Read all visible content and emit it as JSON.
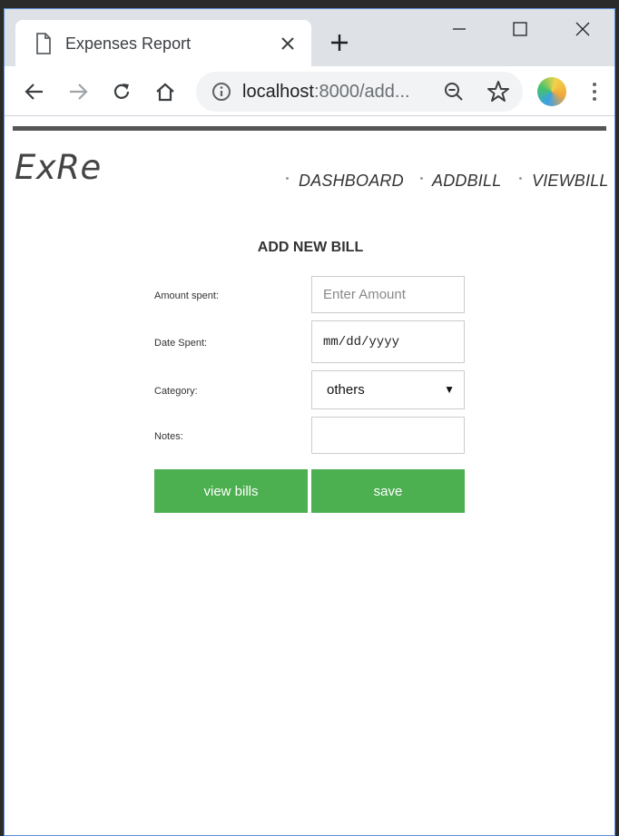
{
  "browser": {
    "tab_title": "Expenses Report",
    "url_host": "localhost",
    "url_rest": ":8000/add..."
  },
  "app": {
    "logo": "ExRe",
    "nav": [
      {
        "label": "DASHBOARD"
      },
      {
        "label": "ADDBILL"
      },
      {
        "label": "VIEWBILL"
      }
    ]
  },
  "form": {
    "title": "ADD NEW BILL",
    "amount_label": "Amount spent:",
    "amount_placeholder": "Enter Amount",
    "date_label": "Date Spent:",
    "date_placeholder": "mm/dd/yyyy",
    "category_label": "Category:",
    "category_value": "others",
    "notes_label": "Notes:",
    "notes_value": "",
    "view_button": "view bills",
    "save_button": "save"
  },
  "colors": {
    "accent": "#4caf50",
    "topbar": "#555555",
    "window_border": "#5c8ed6"
  },
  "icons": [
    "page-icon",
    "close-icon",
    "plus-icon",
    "minimize-icon",
    "maximize-icon",
    "back-icon",
    "forward-icon",
    "reload-icon",
    "home-icon",
    "info-icon",
    "zoom-icon",
    "star-icon",
    "menu-icon"
  ]
}
